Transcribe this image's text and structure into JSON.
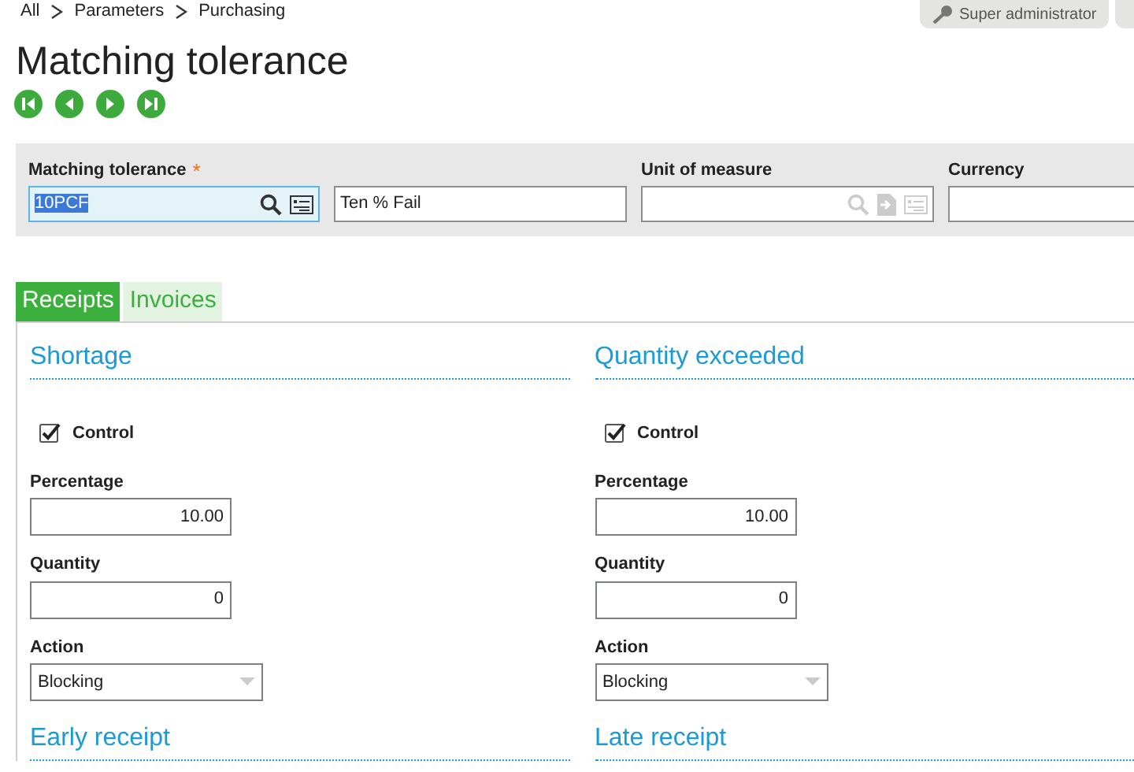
{
  "breadcrumb": [
    "All",
    "Parameters",
    "Purchasing"
  ],
  "user": {
    "label": "Super administrator"
  },
  "title": "Matching tolerance",
  "header_fields": [
    {
      "label": "Matching tolerance",
      "required_mark": "*",
      "value": "10PCF",
      "focused": true,
      "kind": "lookup"
    },
    {
      "value": "Ten % Fail",
      "focused": false,
      "kind": "text"
    },
    {
      "label": "Unit of measure",
      "focused": false,
      "kind": "lookup-disabled"
    },
    {
      "label": "Currency",
      "focused": false,
      "kind": "text"
    }
  ],
  "tabs": [
    {
      "label": "Receipts",
      "selected": true
    },
    {
      "label": "Invoices",
      "selected": false
    }
  ],
  "sections": [
    {
      "title": "Shortage",
      "control": {
        "label": "Control",
        "checked": true
      },
      "percentage": {
        "label": "Percentage",
        "value": "10.00"
      },
      "quantity": {
        "label": "Quantity",
        "value": "0"
      },
      "action": {
        "label": "Action",
        "value": "Blocking"
      }
    },
    {
      "title": "Quantity exceeded",
      "control": {
        "label": "Control",
        "checked": true
      },
      "percentage": {
        "label": "Percentage",
        "value": "10.00"
      },
      "quantity": {
        "label": "Quantity",
        "value": "0"
      },
      "action": {
        "label": "Action",
        "value": "Blocking"
      }
    }
  ],
  "next_sections": [
    "Early receipt",
    "Late receipt"
  ]
}
